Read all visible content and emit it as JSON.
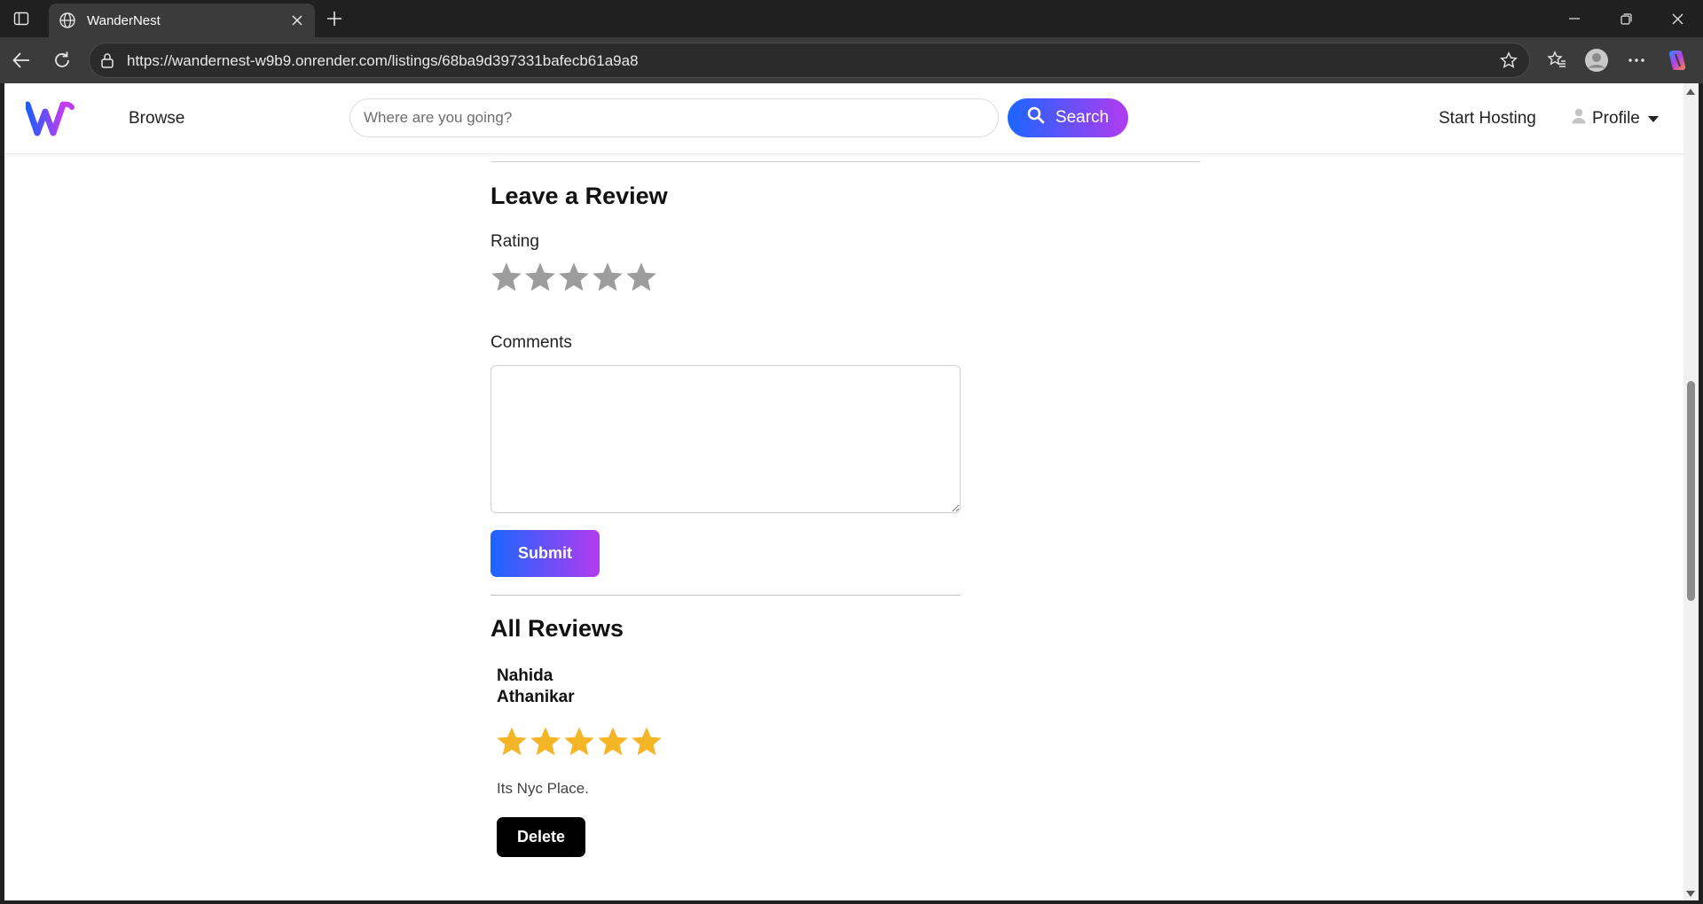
{
  "browser": {
    "tab_title": "WanderNest",
    "url": "https://wandernest-w9b9.onrender.com/listings/68ba9d397331bafecb61a9a8",
    "icons": [
      "sidebar-toggle-icon",
      "globe-icon",
      "close-icon",
      "plus-icon",
      "minimize-icon",
      "restore-icon",
      "close-window-icon",
      "back-icon",
      "refresh-icon",
      "lock-icon",
      "star-icon",
      "favorites-icon",
      "profile-icon",
      "more-icon",
      "copilot-icon"
    ]
  },
  "nav": {
    "browse": "Browse",
    "search_placeholder": "Where are you going?",
    "search_label": "Search",
    "start_hosting": "Start Hosting",
    "profile": "Profile",
    "colors": {
      "gradient_start": "#1a66ff",
      "gradient_end": "#b23bf0"
    }
  },
  "review_form": {
    "heading": "Leave a Review",
    "rating_label": "Rating",
    "rating_value": 0,
    "rating_max": 5,
    "comments_label": "Comments",
    "comments_value": "",
    "submit_label": "Submit"
  },
  "reviews": {
    "heading": "All Reviews",
    "items": [
      {
        "author": "Nahida Athanikar",
        "rating": 5,
        "comment": "Its Nyc Place.",
        "delete_label": "Delete"
      }
    ]
  }
}
